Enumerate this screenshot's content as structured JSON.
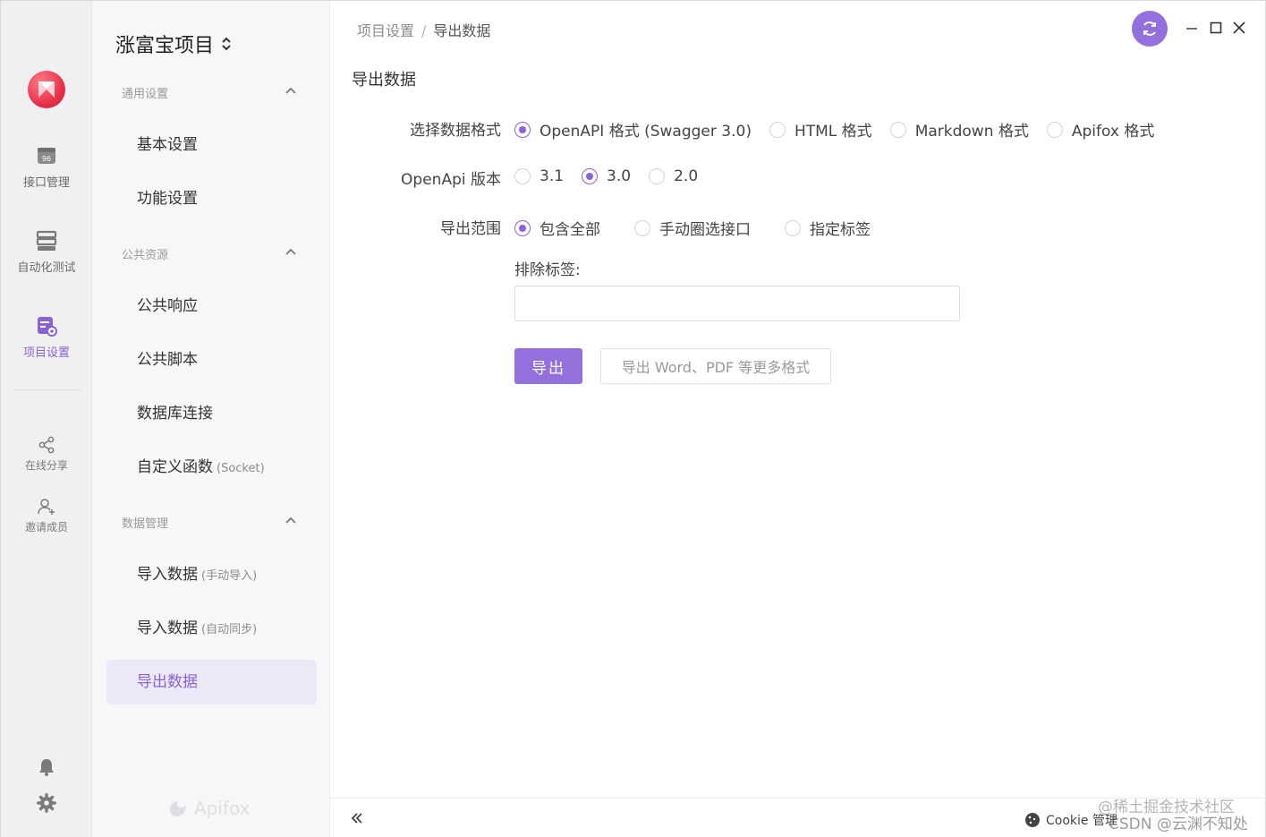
{
  "rail": {
    "items": [
      {
        "label": "接口管理",
        "icon": "api-icon"
      },
      {
        "label": "自动化测试",
        "icon": "automation-icon"
      },
      {
        "label": "项目设置",
        "icon": "project-settings-icon",
        "active": true
      },
      {
        "label": "在线分享",
        "icon": "share-icon"
      },
      {
        "label": "邀请成员",
        "icon": "invite-user-icon"
      }
    ]
  },
  "sidebar": {
    "project_name": "涨富宝项目",
    "groups": [
      {
        "label": "通用设置"
      },
      {
        "label": "公共资源"
      },
      {
        "label": "数据管理"
      }
    ],
    "items": [
      {
        "label": "基本设置",
        "sub": ""
      },
      {
        "label": "功能设置",
        "sub": ""
      },
      {
        "label": "公共响应",
        "sub": ""
      },
      {
        "label": "公共脚本",
        "sub": ""
      },
      {
        "label": "数据库连接",
        "sub": ""
      },
      {
        "label": "自定义函数",
        "sub": "(Socket)"
      },
      {
        "label": "导入数据",
        "sub": "(手动导入)"
      },
      {
        "label": "导入数据",
        "sub": "(自动同步)"
      },
      {
        "label": "导出数据",
        "sub": "",
        "active": true
      }
    ],
    "footer_brand": "Apifox"
  },
  "breadcrumb": {
    "parent": "项目设置",
    "separator": "/",
    "current": "导出数据"
  },
  "main": {
    "title": "导出数据",
    "format": {
      "label": "选择数据格式",
      "options": [
        "OpenAPI 格式 (Swagger 3.0)",
        "HTML 格式",
        "Markdown 格式",
        "Apifox 格式"
      ],
      "selected": "OpenAPI 格式 (Swagger 3.0)"
    },
    "version": {
      "label": "OpenApi 版本",
      "options": [
        "3.1",
        "3.0",
        "2.0"
      ],
      "selected": "3.0"
    },
    "scope": {
      "label": "导出范围",
      "options": [
        "包含全部",
        "手动圈选接口",
        "指定标签"
      ],
      "selected": "包含全部"
    },
    "exclude_tags": {
      "label": "排除标签:",
      "value": ""
    },
    "export_button": "导出",
    "more_formats_button": "导出 Word、PDF 等更多格式"
  },
  "bottom": {
    "cookie_label": "Cookie 管理",
    "watermark_top": "@稀土掘金技术社区",
    "watermark_bottom": "CSDN @云渊不知处"
  },
  "colors": {
    "accent": "#9370db",
    "accent_text": "#8a63d2",
    "active_bg": "#ece8f7"
  }
}
